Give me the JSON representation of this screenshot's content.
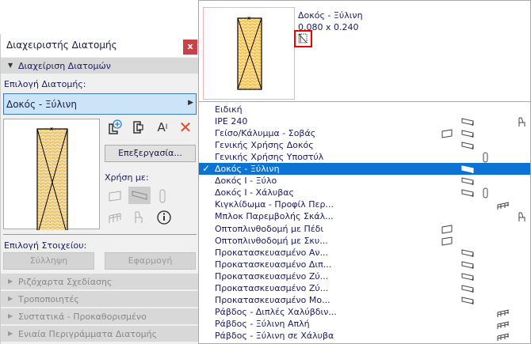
{
  "panel": {
    "title": "Διαχειριστής Διατομής",
    "close": "x",
    "section_main": "Διαχείριση Διατομών",
    "select_profile_label": "Επιλογή Διατομής:",
    "selected_profile": "Δοκός - Ξύλινη",
    "edit_button": "Επεξεργασία...",
    "use_with_label": "Χρήση με:",
    "select_element_label": "Επιλογή Στοιχείου:",
    "capture_button": "Σύλληψη",
    "apply_button": "Εφαρμογή",
    "sections": [
      "Ριζόχαρτα Σχεδίασης",
      "Τροποποιητές",
      "Συστατικά - Προκαθορισμένο",
      "Ενιαία Περιγράμματα Διατομής"
    ]
  },
  "popup": {
    "name": "Δοκός - Ξύλινη",
    "size": "0.080 x 0.240",
    "items": [
      {
        "label": "Ειδική",
        "icons": []
      },
      {
        "label": "IPE 240",
        "icons": [
          "beam",
          "object"
        ]
      },
      {
        "label": "Γείσο/Κάλυμμα - Σοβάς",
        "icons": [
          "wall",
          "beam"
        ]
      },
      {
        "label": "Γενικής Χρήσης Δοκός",
        "icons": [
          "beam"
        ]
      },
      {
        "label": "Γενικής Χρήσης Υποστύλ",
        "icons": [
          "column"
        ]
      },
      {
        "label": "Δοκός - Ξύλινη",
        "icons": [
          "beam"
        ],
        "selected": true
      },
      {
        "label": "Δοκός Ι - Ξύλο",
        "icons": [
          "beam"
        ]
      },
      {
        "label": "Δοκός Ι - Χάλυβας",
        "icons": [
          "beam",
          "column"
        ]
      },
      {
        "label": "Κιγκλίδωμα - Προφίλ Περ...",
        "icons": [
          "railing"
        ]
      },
      {
        "label": "Μπλοκ Παρεμβολής Σκάλ...",
        "icons": [
          "object"
        ]
      },
      {
        "label": "Οπτοπλινθοδομή με Πέδι",
        "icons": [
          "wall"
        ]
      },
      {
        "label": "Οπτοπλινθοδομή με Σκυ...",
        "icons": [
          "wall"
        ]
      },
      {
        "label": "Προκατασκευασμένο Αν...",
        "icons": [
          "beam"
        ]
      },
      {
        "label": "Προκατασκευασμένο Διπ...",
        "icons": [
          "beam"
        ]
      },
      {
        "label": "Προκατασκευασμένο Ζύ...",
        "icons": [
          "beam"
        ]
      },
      {
        "label": "Προκατασκευασμένο Ζύ...",
        "icons": [
          "beam"
        ]
      },
      {
        "label": "Προκατασκευασμένο Μο...",
        "icons": [
          "beam"
        ]
      },
      {
        "label": "Ράβδος - Διπλές Χαλύβδιν...",
        "icons": [
          "railing"
        ]
      },
      {
        "label": "Ράβδος - Ξύλινη Απλή",
        "icons": [
          "railing"
        ]
      },
      {
        "label": "Ράβδος - Ξύλινη σε Χάλυβα",
        "icons": [
          "railing"
        ]
      }
    ]
  },
  "colors": {
    "accent": "#0a73d4",
    "close": "#c8424a",
    "delete": "#e8452c",
    "hatch": "#f2b33d"
  }
}
